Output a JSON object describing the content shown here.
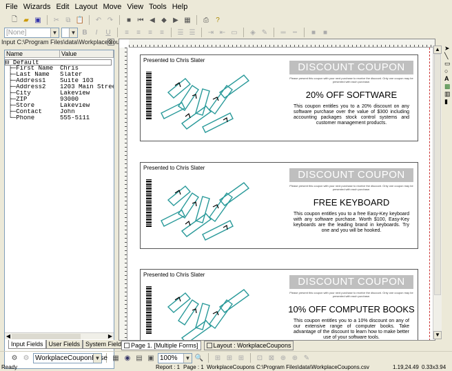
{
  "menu": [
    "File",
    "Wizards",
    "Edit",
    "Layout",
    "Move",
    "View",
    "Tools",
    "Help"
  ],
  "format": {
    "style": "[None]",
    "bold": "B",
    "italic": "I",
    "underline": "U"
  },
  "panel": {
    "title": "Input C:\\Program Files\\data\\WorkplaceCoup...",
    "col_name": "Name",
    "col_value": "Value",
    "root": "Default",
    "fields": [
      {
        "name": "First Name",
        "value": "Chris"
      },
      {
        "name": "Last Name",
        "value": "Slater"
      },
      {
        "name": "Address1",
        "value": "Suite 103"
      },
      {
        "name": "Address2",
        "value": "1203 Main Stree"
      },
      {
        "name": "City",
        "value": "Lakeview"
      },
      {
        "name": "ZIP",
        "value": "93000"
      },
      {
        "name": "Store",
        "value": "Lakeview"
      },
      {
        "name": "Contact",
        "value": "John"
      },
      {
        "name": "Phone",
        "value": "555-5111"
      }
    ],
    "tabs": [
      "Input Fields",
      "User Fields",
      "System Fields"
    ]
  },
  "coupons": [
    {
      "presented": "Presented to Chris Slater",
      "banner": "DISCOUNT COUPON",
      "fine": "Please present this coupon with your next purchase to receive the discount. Only one coupon may be presented with each purchase.",
      "offer": "20% OFF SOFTWARE",
      "body": "This coupon entitles you to a 20% discount on any software purchase over the value of $300 including accounting packages stock control systems and customer management products."
    },
    {
      "presented": "Presented to Chris Slater",
      "banner": "DISCOUNT COUPON",
      "fine": "Please present this coupon with your next purchase to receive the discount. Only one coupon may be presented with each purchase.",
      "offer": "FREE KEYBOARD",
      "body": "This coupon entitles you to a free Easy-Key keyboard with any software purchase. Worth $100, Easy-Key keyboards are the leading brand in keyboards. Try one and you will be hooked."
    },
    {
      "presented": "Presented to Chris Slater",
      "banner": "DISCOUNT COUPON",
      "fine": "Please present this coupon with your next purchase to receive the discount. Only one coupon may be presented with each purchase.",
      "offer": "10% OFF COMPUTER BOOKS",
      "body": "This coupon entitles you to a 10% discount on any of our extensive range of computer books. Take advantage of the discount to learn how to make better use of your software tools."
    }
  ],
  "doc_tabs": [
    "Page 1. [Multiple Forms]",
    "Layout : WorkplaceCoupons"
  ],
  "bottom": {
    "layout_combo": "WorkplaceCouponBase",
    "zoom": "100%"
  },
  "status": {
    "ready": "Ready",
    "report": "Report : 1",
    "page": "Page : 1",
    "layout": "WorkplaceCoupons",
    "file": "C:\\Program Files\\data\\WorkplaceCoupons.csv",
    "coords": "1.19,24.49",
    "size": "0.33x3.94"
  }
}
